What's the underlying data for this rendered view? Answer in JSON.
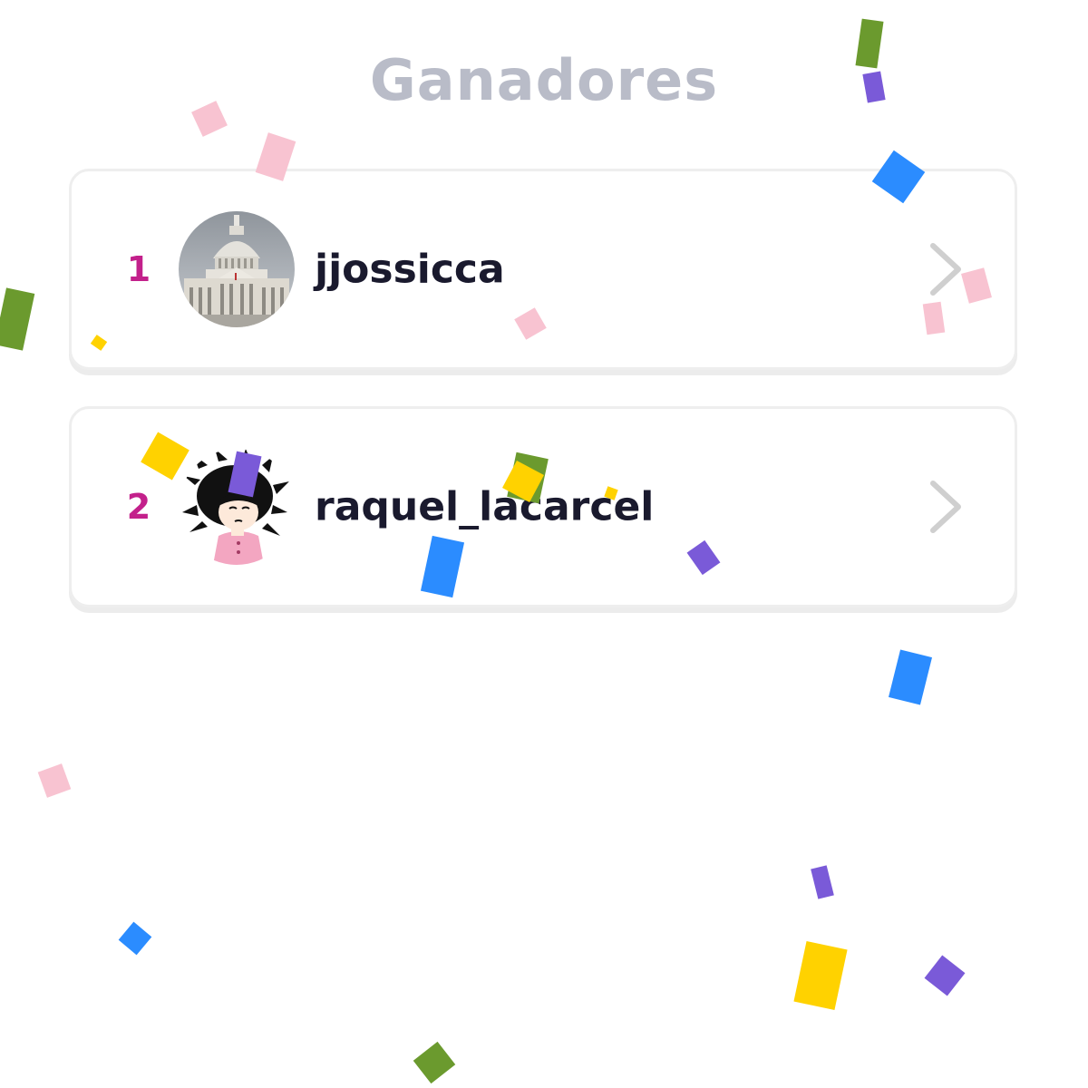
{
  "header": {
    "title": "Ganadores"
  },
  "winners": [
    {
      "rank": "1",
      "username": "jjossicca",
      "avatar_icon": "capitol-building-avatar"
    },
    {
      "rank": "2",
      "username": "raquel_lacarcel",
      "avatar_icon": "cartoon-girl-avatar"
    }
  ],
  "colors": {
    "title": "#b9bcc8",
    "rank": "#c3208b",
    "username": "#1a1a2e",
    "chevron": "#cfcfcf",
    "card_border": "#eeeeee",
    "confetti": [
      "#6b9a2e",
      "#7a5ad8",
      "#2b8cff",
      "#ffd200",
      "#f8c3d1"
    ]
  },
  "decorations": {
    "confetti_icon": "confetti-icon"
  }
}
